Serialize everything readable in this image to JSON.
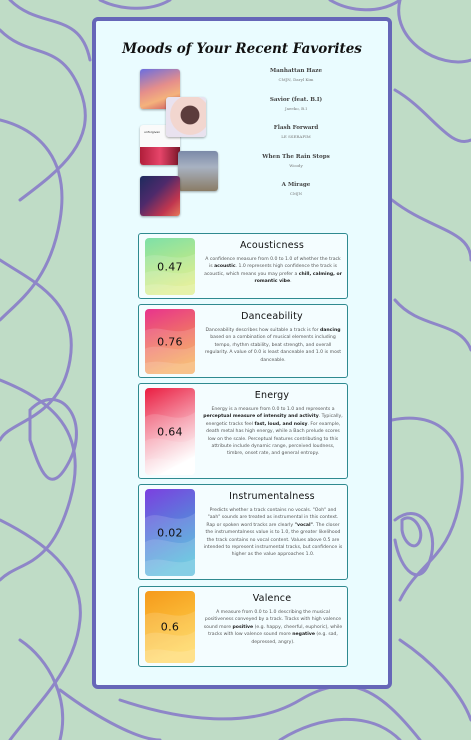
{
  "title": "Moods of Your Recent Favorites",
  "tracks": [
    {
      "name": "Manhattan Haze",
      "artist": "CMJN, Daryl Kim"
    },
    {
      "name": "Savior (feat. B.I)",
      "artist": "Jaeeko, B.I"
    },
    {
      "name": "Flash Forward",
      "artist": "LE SSERAFIM"
    },
    {
      "name": "When The Rain Stops",
      "artist": "Woody"
    },
    {
      "name": "A Mirage",
      "artist": "CMJN"
    }
  ],
  "cover_art_text": "unforgiven",
  "features": [
    {
      "name": "Acousticness",
      "value": "0.47",
      "level": 0.47,
      "colors": [
        "#7ee0a8",
        "#d8ec7a"
      ],
      "desc": [
        {
          "t": "A confidence measure from 0.0 to 1.0 of whether the track is "
        },
        {
          "t": "acoustic",
          "b": true
        },
        {
          "t": ". 1.0 represents high confidence the track is acoustic, which means you may prefer a "
        },
        {
          "t": "chill, calming, or romantic vibe",
          "b": true
        },
        {
          "t": "."
        }
      ]
    },
    {
      "name": "Danceability",
      "value": "0.76",
      "level": 0.76,
      "colors": [
        "#e8338d",
        "#f5a04a"
      ],
      "desc": [
        {
          "t": "Danceability describes how suitable a track is for "
        },
        {
          "t": "dancing",
          "b": true
        },
        {
          "t": " based on a combination of musical elements including tempo, rhythm stability, beat strength, and overall regularity. A value of 0.0 is least danceable and 1.0 is most danceable."
        }
      ]
    },
    {
      "name": "Energy",
      "value": "0.64",
      "level": 0.64,
      "colors": [
        "#ea1d41",
        "#ffffff"
      ],
      "desc": [
        {
          "t": "Energy is a measure from 0.0 to 1.0 and represents a "
        },
        {
          "t": "perceptual measure of intensity and activity",
          "b": true
        },
        {
          "t": ". Typically, energetic tracks feel "
        },
        {
          "t": "fast, loud, and noisy",
          "b": true
        },
        {
          "t": ". For example, death metal has high energy, while a Bach prelude scores low on the scale. Perceptual features contributing to this attribute include dynamic range, perceived loudness, timbre, onset rate, and general entropy."
        }
      ]
    },
    {
      "name": "Instrumentalness",
      "value": "0.02",
      "level": 0.02,
      "colors": [
        "#7c3fe0",
        "#3fb3d8"
      ],
      "desc": [
        {
          "t": "Predicts whether a track contains no vocals. \"Ooh\" and \"aah\" sounds are treated as instrumental in this context. Rap or spoken word tracks are clearly "
        },
        {
          "t": "\"vocal\"",
          "b": true
        },
        {
          "t": ". The closer the instrumentalness value is to 1.0, the greater likelihood the track contains no vocal content. Values above 0.5 are intended to represent instrumental tracks, but confidence is higher as the value approaches 1.0."
        }
      ]
    },
    {
      "name": "Valence",
      "value": "0.6",
      "level": 0.6,
      "colors": [
        "#f59a1c",
        "#ffd24a"
      ],
      "desc": [
        {
          "t": "A measure from 0.0 to 1.0 describing the musical positiveness conveyed by a track. Tracks with high valence sound more "
        },
        {
          "t": "positive",
          "b": true
        },
        {
          "t": " (e.g. happy, cheerful, euphoric), while tracks with low valence sound more "
        },
        {
          "t": "negative",
          "b": true
        },
        {
          "t": " (e.g. sad, depressed, angry)."
        }
      ]
    }
  ]
}
